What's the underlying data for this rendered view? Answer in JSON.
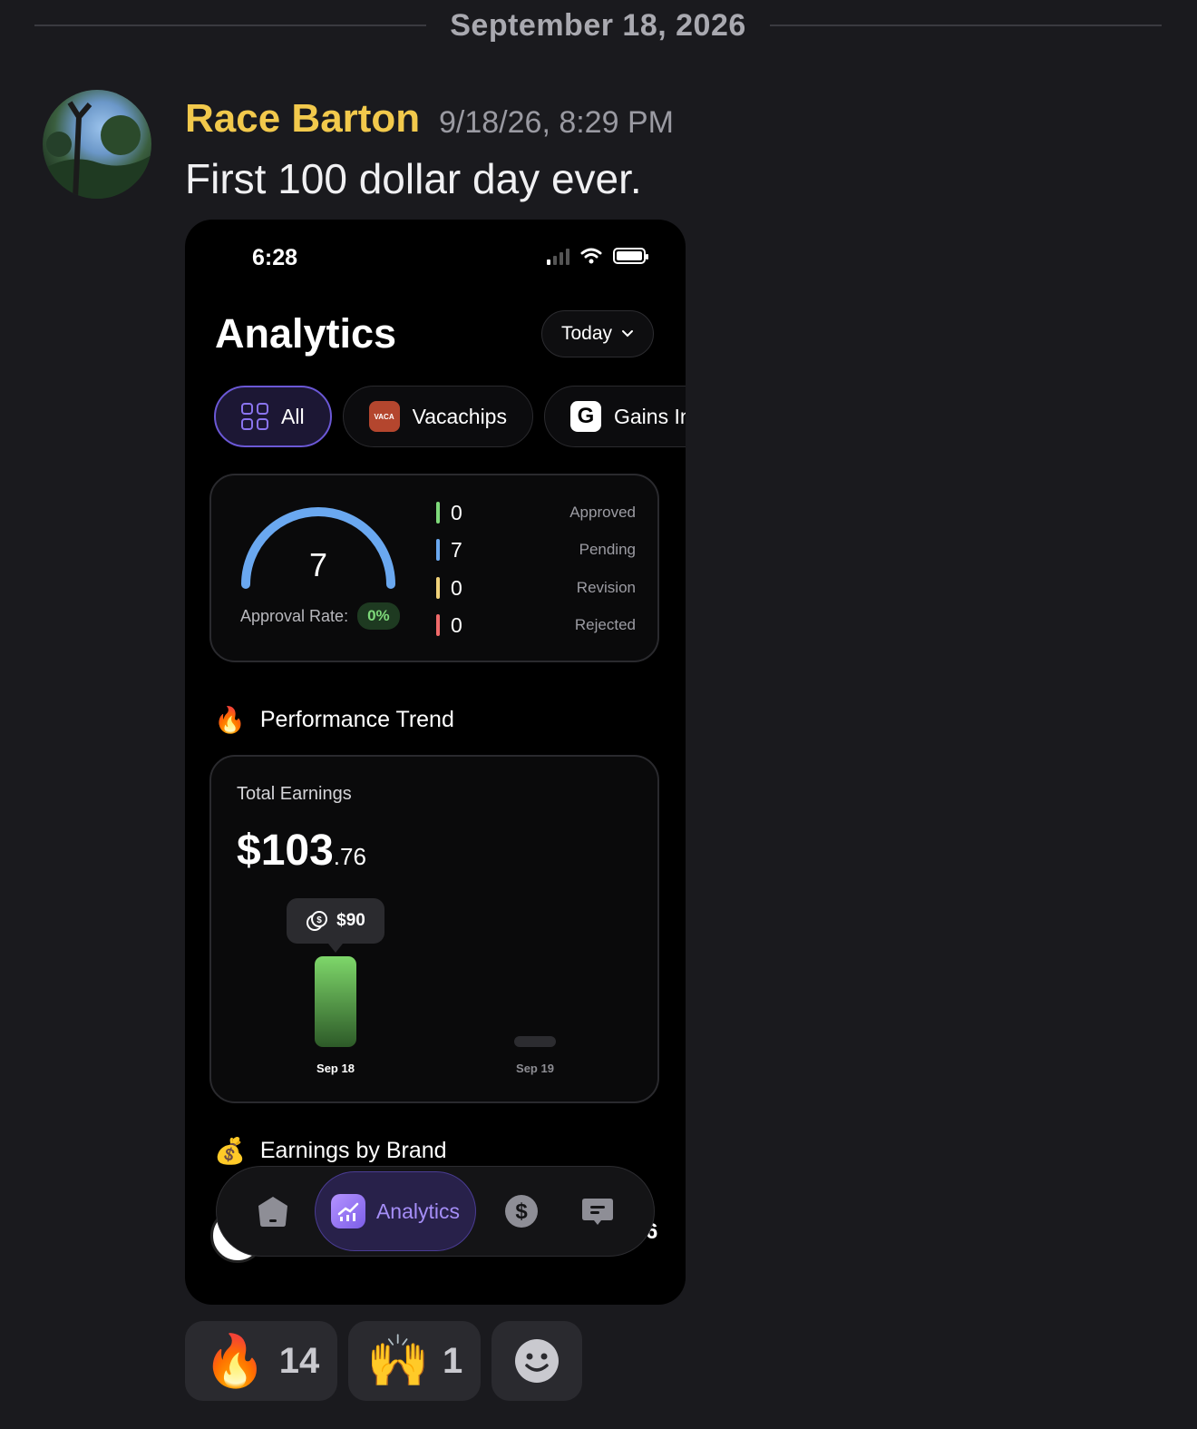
{
  "date_divider": "September 18, 2026",
  "message": {
    "author": "Race Barton",
    "timestamp": "9/18/26, 8:29 PM",
    "text": "First 100 dollar day ever."
  },
  "phone": {
    "status_time": "6:28",
    "page_title": "Analytics",
    "period": "Today",
    "filters": [
      {
        "label": "All",
        "active": true
      },
      {
        "label": "Vacachips",
        "logo_text": "VACA"
      },
      {
        "label": "Gains In I",
        "logo_text": "G"
      }
    ],
    "gauge": {
      "value": "7",
      "approval_label": "Approval Rate:",
      "approval_pct": "0%",
      "fill_fraction": 1.0
    },
    "stats": [
      {
        "value": "0",
        "label": "Approved",
        "color": "#7ed97a"
      },
      {
        "value": "7",
        "label": "Pending",
        "color": "#6aa8f0"
      },
      {
        "value": "0",
        "label": "Revision",
        "color": "#f0d27a"
      },
      {
        "value": "0",
        "label": "Rejected",
        "color": "#f06a6a"
      }
    ],
    "performance_title": "Performance Trend",
    "total_label": "Total Earnings",
    "total_dollars": "$103",
    "total_cents": ".76",
    "tooltip": "$90",
    "earnings_title": "Earnings by Brand",
    "nav": {
      "active_label": "Analytics"
    },
    "peek_digit": "6"
  },
  "chart_data": {
    "type": "bar",
    "categories": [
      "Sep 18",
      "Sep 19"
    ],
    "values": [
      90,
      0
    ],
    "ylim": [
      0,
      90
    ],
    "annotations": [
      {
        "category": "Sep 18",
        "label": "$90"
      }
    ]
  },
  "reactions": [
    {
      "emoji": "🔥",
      "count": "14",
      "icon": "fire-icon"
    },
    {
      "emoji": "🙌",
      "count": "1",
      "icon": "raised-hands-icon"
    }
  ],
  "colors": {
    "background": "#1a1a1e",
    "author": "#f2c94c",
    "accent": "#6b58d6",
    "bar": "#7ed76a"
  }
}
